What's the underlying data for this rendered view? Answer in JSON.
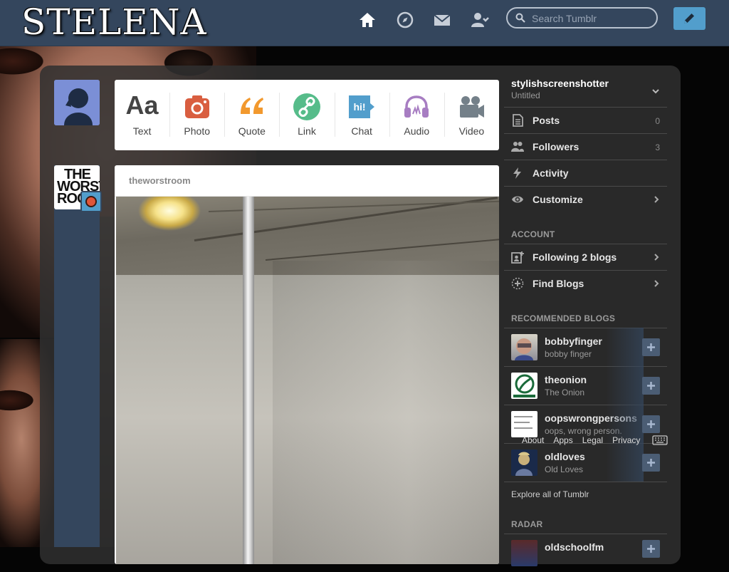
{
  "header": {
    "logo_text": "STELENA",
    "search_placeholder": "Search Tumblr",
    "colors": {
      "bar": "#34465d",
      "compose": "#529ecc"
    }
  },
  "composer": {
    "types": [
      {
        "label": "Text",
        "icon": "text-aa-icon",
        "color": "#444444"
      },
      {
        "label": "Photo",
        "icon": "camera-icon",
        "color": "#d95e40"
      },
      {
        "label": "Quote",
        "icon": "quote-icon",
        "color": "#f2992e"
      },
      {
        "label": "Link",
        "icon": "link-icon",
        "color": "#56bc8a"
      },
      {
        "label": "Chat",
        "icon": "chat-icon",
        "color": "#529ecc"
      },
      {
        "label": "Audio",
        "icon": "headphones-icon",
        "color": "#a77dc2"
      },
      {
        "label": "Video",
        "icon": "video-camera-icon",
        "color": "#748089"
      }
    ]
  },
  "post": {
    "blog_name": "theworstroom",
    "avatar_text": [
      "THE",
      "WORST",
      "ROO"
    ]
  },
  "sidebar": {
    "blog_title": "stylishscreenshotter",
    "blog_subtitle": "Untitled",
    "stats": [
      {
        "label": "Posts",
        "count": "0",
        "icon": "posts-icon"
      },
      {
        "label": "Followers",
        "count": "3",
        "icon": "followers-icon"
      },
      {
        "label": "Activity",
        "count": "",
        "icon": "activity-bolt-icon"
      },
      {
        "label": "Customize",
        "count": "",
        "icon": "eye-icon"
      }
    ],
    "account_heading": "ACCOUNT",
    "account_links": [
      {
        "label": "Following 2 blogs",
        "icon": "following-icon"
      },
      {
        "label": "Find Blogs",
        "icon": "find-blogs-icon"
      }
    ],
    "recommended_heading": "RECOMMENDED BLOGS",
    "recommended": [
      {
        "name": "bobbyfinger",
        "title": "bobby finger"
      },
      {
        "name": "theonion",
        "title": "The Onion"
      },
      {
        "name": "oopswrongpersons",
        "title": "oops, wrong person."
      },
      {
        "name": "oldloves",
        "title": "Old Loves"
      }
    ],
    "explore_label": "Explore all of Tumblr",
    "radar_heading": "RADAR",
    "radar_blog": "oldschoolfm"
  },
  "footer": {
    "links": [
      "About",
      "Apps",
      "Legal",
      "Privacy"
    ]
  }
}
